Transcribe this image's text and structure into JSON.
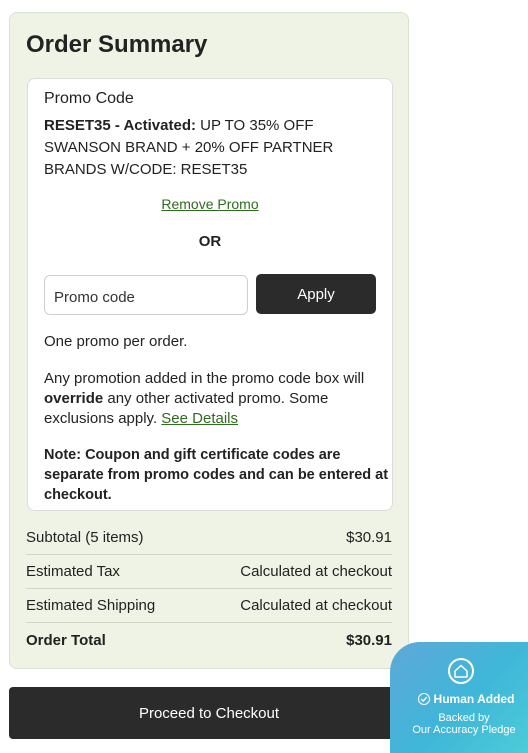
{
  "summary": {
    "title": "Order Summary"
  },
  "promo": {
    "heading": "Promo Code",
    "active_code": "RESET35 - Activated:",
    "active_desc": " UP TO 35% OFF SWANSON BRAND + 20% OFF PARTNER BRANDS W/CODE: RESET35",
    "remove_label": "Remove Promo",
    "or_label": "OR",
    "input_placeholder": "Promo code",
    "apply_label": "Apply",
    "one_per_order": "One promo per order.",
    "override_pre": "Any promotion added in the promo code box will ",
    "override_bold": "override",
    "override_post": " any other activated promo. Some exclusions apply. ",
    "see_details": "See Details",
    "coupon_note": "Note: Coupon and gift certificate codes are separate from promo codes and can be entered at checkout."
  },
  "totals": {
    "rows": [
      {
        "label": "Subtotal (5 items)",
        "value": "$30.91"
      },
      {
        "label": "Estimated Tax",
        "value": "Calculated at checkout"
      },
      {
        "label": "Estimated Shipping",
        "value": "Calculated at checkout"
      },
      {
        "label": "Order Total",
        "value": "$30.91"
      }
    ]
  },
  "checkout": {
    "label": "Proceed to Checkout"
  },
  "badge": {
    "title": "Human Added",
    "subtitle_1": "Backed by",
    "subtitle_2": "Our Accuracy Pledge",
    "icons": [
      "house-icon",
      "check-circle-icon"
    ]
  }
}
